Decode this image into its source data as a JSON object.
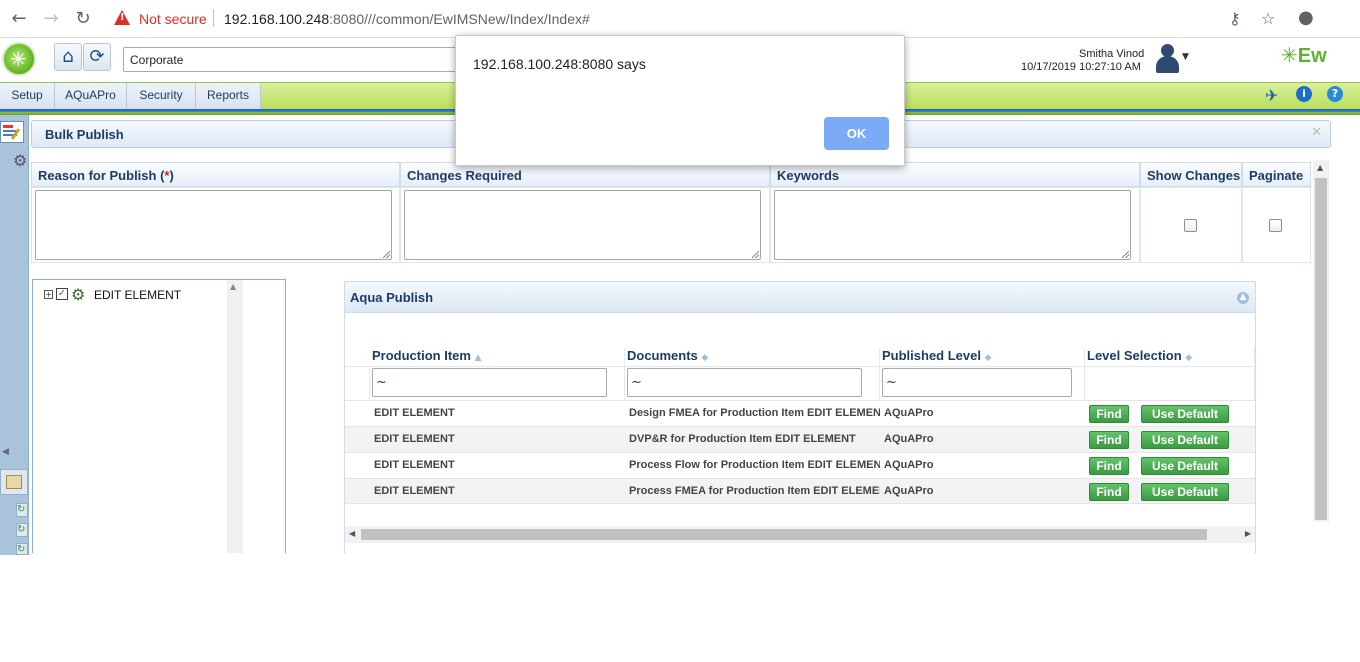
{
  "browser": {
    "security_label": "Not secure",
    "url_host": "192.168.100.248",
    "url_rest": ":8080///common/EwIMSNew/Index/Index#"
  },
  "header": {
    "company_select": "Corporate",
    "user_name": "Smitha Vinod",
    "datetime": "10/17/2019 10:27:10 AM",
    "brand": "Ew"
  },
  "menu": {
    "items": [
      "Setup",
      "AQuAPro",
      "Security",
      "Reports"
    ]
  },
  "panel": {
    "title": "Bulk Publish",
    "close": "✕"
  },
  "form": {
    "reason_label": "Reason for Publish (",
    "required_mark": "*",
    "reason_close": ")",
    "changes_label": "Changes Required",
    "keywords_label": "Keywords",
    "show_changes_label": "Show Changes",
    "paginate_label": "Paginate"
  },
  "tree": {
    "root_label": "EDIT ELEMENT"
  },
  "grid": {
    "title": "Aqua Publish",
    "columns": [
      "Production Item",
      "Documents",
      "Published Level",
      "Level Selection"
    ],
    "filter_value": "~",
    "find_label": "Find",
    "default_label": "Use Default",
    "rows": [
      {
        "item": "EDIT ELEMENT",
        "document": "Design FMEA for Production Item  EDIT ELEMENT",
        "level": "AQuAPro"
      },
      {
        "item": "EDIT ELEMENT",
        "document": "DVP&R for Production Item  EDIT ELEMENT",
        "level": "AQuAPro"
      },
      {
        "item": "EDIT ELEMENT",
        "document": "Process Flow for Production Item  EDIT ELEMENT",
        "level": "AQuAPro"
      },
      {
        "item": "EDIT ELEMENT",
        "document": "Process FMEA for Production Item  EDIT ELEMENT",
        "level": "AQuAPro"
      }
    ]
  },
  "dialog": {
    "message": "192.168.100.248:8080 says",
    "ok_label": "OK"
  },
  "colors": {
    "accent_blue": "#1c3c68",
    "button_green": "#3c9a43",
    "dialog_button": "#7baaf7",
    "warning_red": "#d93025"
  }
}
